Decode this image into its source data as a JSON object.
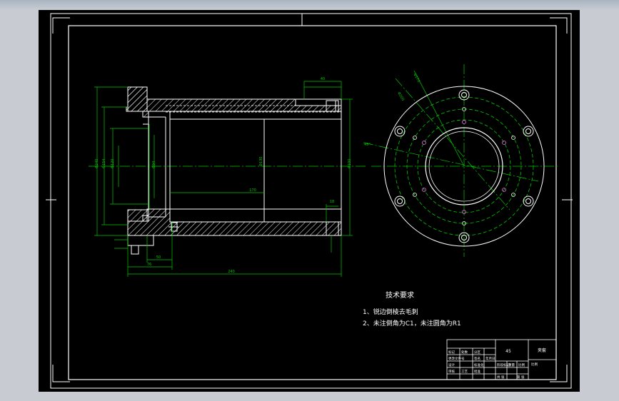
{
  "drawing": {
    "background": "#000000",
    "line_color": "#ffffff",
    "center_color": "#00c800",
    "dim_color": "#00c800",
    "hatch_color": "#ffffff",
    "hole_color": "#ff66ff",
    "tech_title": "技术要求",
    "tech_line1": "1、锐边倒棱去毛刺",
    "tech_line2": "2、未注倒角为C1，未注圆角为R1",
    "dims": {
      "total_length": "240",
      "length_partial": "76",
      "length_small": "50",
      "length_tiny": "18",
      "inner_length": "170",
      "top_right": "40",
      "dia_outer": "Φ240",
      "dia_body": "Φ154",
      "dia_inner": "Φ120",
      "dia_bore": "Φ100",
      "dia_a": "Φ130",
      "dia_b": "Φ94",
      "dia_pcd": "Φ200",
      "dia_pcd2": "Φ170",
      "angle": "45°"
    },
    "title_block": {
      "material": "45",
      "name": "夹套",
      "scale_label": "比例",
      "cells": [
        "标记",
        "处数",
        "分区",
        "更改文件号",
        "签名",
        "年月日",
        "设计",
        "标准化",
        "审核",
        "工艺",
        "批准",
        "阶段标记",
        "重量",
        "比例",
        "共 张",
        "第 张"
      ]
    }
  }
}
